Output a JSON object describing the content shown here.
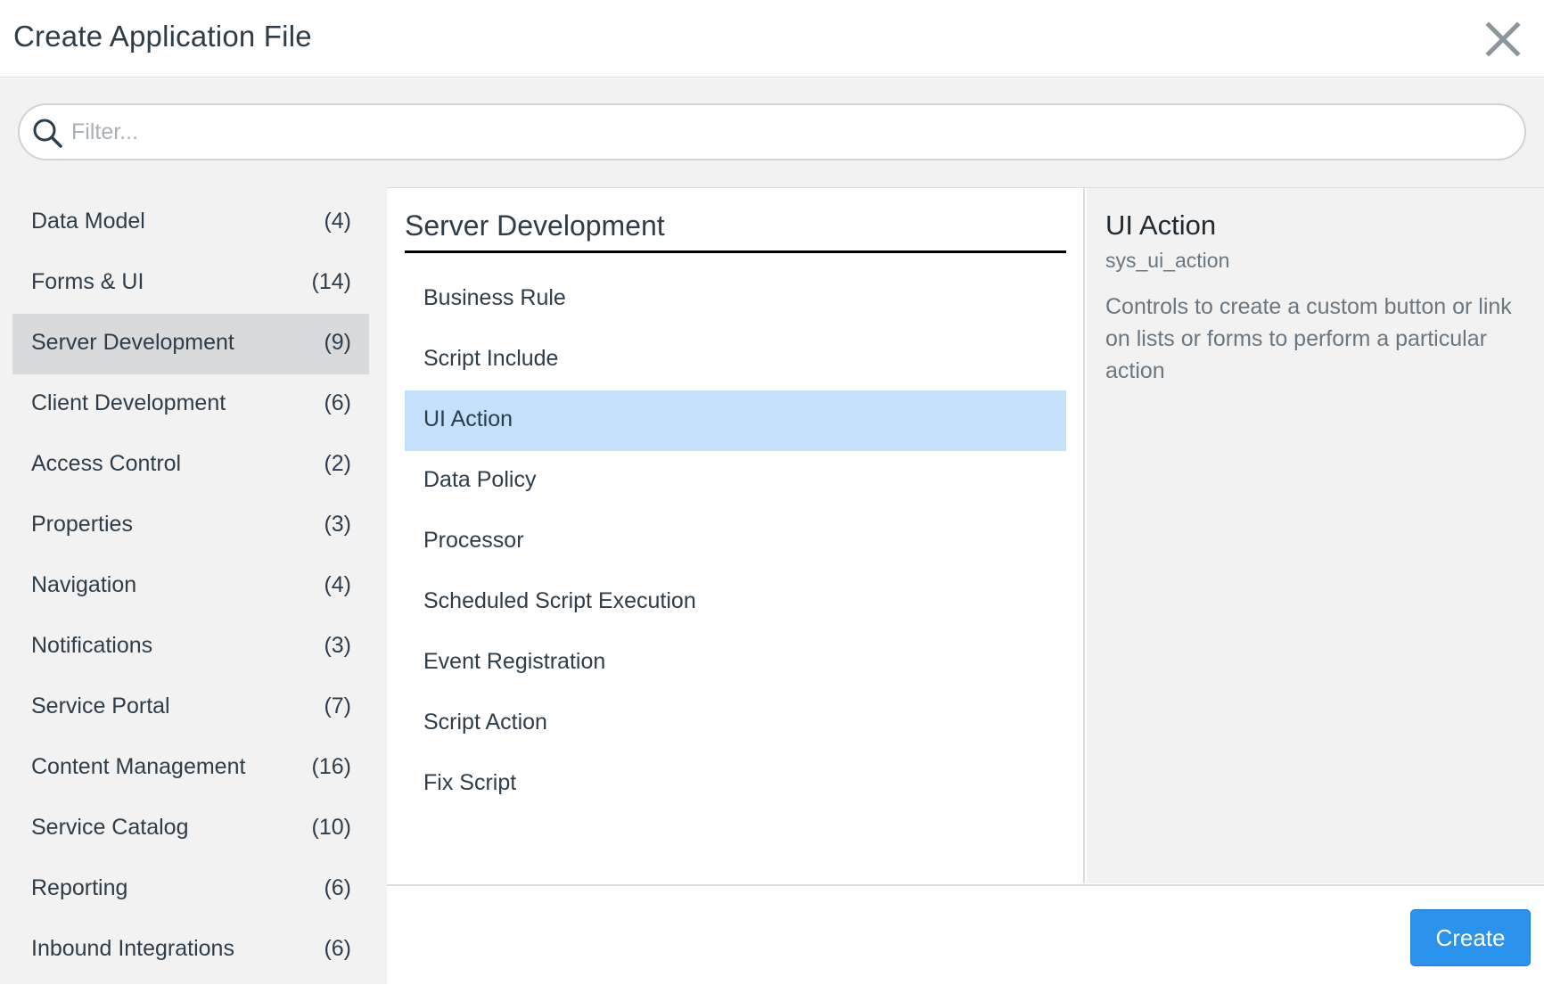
{
  "dialog": {
    "title": "Create Application File",
    "close_icon": "close-icon"
  },
  "filter": {
    "placeholder": "Filter...",
    "value": "",
    "icon": "search-icon"
  },
  "categories": [
    {
      "label": "Data Model",
      "count": "(4)"
    },
    {
      "label": "Forms & UI",
      "count": "(14)"
    },
    {
      "label": "Server Development",
      "count": "(9)",
      "selected": true
    },
    {
      "label": "Client Development",
      "count": "(6)"
    },
    {
      "label": "Access Control",
      "count": "(2)"
    },
    {
      "label": "Properties",
      "count": "(3)"
    },
    {
      "label": "Navigation",
      "count": "(4)"
    },
    {
      "label": "Notifications",
      "count": "(3)"
    },
    {
      "label": "Service Portal",
      "count": "(7)"
    },
    {
      "label": "Content Management",
      "count": "(16)"
    },
    {
      "label": "Service Catalog",
      "count": "(10)"
    },
    {
      "label": "Reporting",
      "count": "(6)"
    },
    {
      "label": "Inbound Integrations",
      "count": "(6)"
    }
  ],
  "file_types": {
    "heading": "Server Development",
    "items": [
      {
        "label": "Business Rule"
      },
      {
        "label": "Script Include"
      },
      {
        "label": "UI Action",
        "selected": true
      },
      {
        "label": "Data Policy"
      },
      {
        "label": "Processor"
      },
      {
        "label": "Scheduled Script Execution"
      },
      {
        "label": "Event Registration"
      },
      {
        "label": "Script Action"
      },
      {
        "label": "Fix Script"
      }
    ]
  },
  "detail": {
    "title": "UI Action",
    "table": "sys_ui_action",
    "description": "Controls to create a custom button or link on lists or forms to perform a particular action"
  },
  "footer": {
    "create_label": "Create"
  },
  "colors": {
    "selected_category": "#d8dadc",
    "selected_item": "#c5e0fa",
    "primary_button": "#2b93ec"
  }
}
